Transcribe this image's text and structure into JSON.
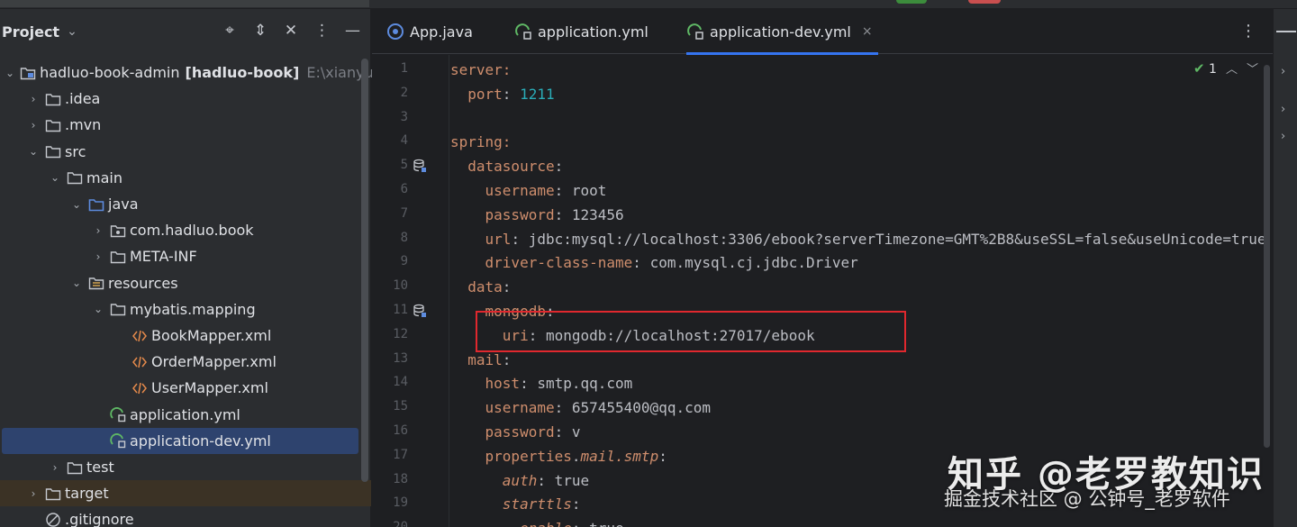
{
  "project_panel": {
    "title": "Project",
    "tools": [
      "locate-icon",
      "expand-collapse-icon",
      "close-all-icon",
      "more-icon",
      "minimize-icon"
    ],
    "tree": [
      {
        "label": "hadluo-book-admin",
        "extra_bold": "[hadluo-book]",
        "path": "E:\\xianyu_ga",
        "icon": "module-folder-icon",
        "expanded": true
      },
      {
        "label": ".idea",
        "icon": "folder-icon",
        "expanded": false
      },
      {
        "label": ".mvn",
        "icon": "folder-icon",
        "expanded": false
      },
      {
        "label": "src",
        "icon": "folder-icon",
        "expanded": true
      },
      {
        "label": "main",
        "icon": "folder-icon",
        "expanded": true
      },
      {
        "label": "java",
        "icon": "source-folder-icon",
        "expanded": true
      },
      {
        "label": "com.hadluo.book",
        "icon": "package-icon",
        "expanded": false
      },
      {
        "label": "META-INF",
        "icon": "folder-icon",
        "expanded": false
      },
      {
        "label": "resources",
        "icon": "resources-folder-icon",
        "expanded": true
      },
      {
        "label": "mybatis.mapping",
        "icon": "folder-icon",
        "expanded": true
      },
      {
        "label": "BookMapper.xml",
        "icon": "xml-icon"
      },
      {
        "label": "OrderMapper.xml",
        "icon": "xml-icon"
      },
      {
        "label": "UserMapper.xml",
        "icon": "xml-icon"
      },
      {
        "label": "application.yml",
        "icon": "spring-yml-icon"
      },
      {
        "label": "application-dev.yml",
        "icon": "spring-yml-icon",
        "selected": true
      },
      {
        "label": "test",
        "icon": "folder-icon",
        "expanded": false
      },
      {
        "label": "target",
        "icon": "folder-icon",
        "expanded": false,
        "highlight": true
      },
      {
        "label": ".gitignore",
        "icon": "ignore-icon"
      }
    ]
  },
  "editor": {
    "tabs": [
      {
        "label": "App.java",
        "icon": "java-class-icon"
      },
      {
        "label": "application.yml",
        "icon": "spring-yml-icon"
      },
      {
        "label": "application-dev.yml",
        "icon": "spring-yml-icon",
        "active": true,
        "close": "×"
      }
    ],
    "inspection": {
      "count": "1"
    },
    "lines": [
      {
        "n": "1",
        "tokens": [
          {
            "t": "server:",
            "c": "k"
          }
        ]
      },
      {
        "n": "2",
        "tokens": [
          {
            "t": "  "
          },
          {
            "t": "port",
            "c": "k"
          },
          {
            "t": ": "
          },
          {
            "t": "1211",
            "c": "n"
          }
        ]
      },
      {
        "n": "3",
        "tokens": []
      },
      {
        "n": "4",
        "tokens": [
          {
            "t": "spring:",
            "c": "k"
          }
        ]
      },
      {
        "n": "5",
        "tokens": [
          {
            "t": "  "
          },
          {
            "t": "datasource",
            "c": "k"
          },
          {
            "t": ":"
          }
        ]
      },
      {
        "n": "6",
        "tokens": [
          {
            "t": "    "
          },
          {
            "t": "username",
            "c": "k"
          },
          {
            "t": ": root"
          }
        ]
      },
      {
        "n": "7",
        "tokens": [
          {
            "t": "    "
          },
          {
            "t": "password",
            "c": "k"
          },
          {
            "t": ": 123456"
          }
        ]
      },
      {
        "n": "8",
        "tokens": [
          {
            "t": "    "
          },
          {
            "t": "url",
            "c": "k"
          },
          {
            "t": ": jdbc:mysql://localhost:3306/ebook?serverTimezone=GMT%2B8&useSSL=false&useUnicode=true"
          }
        ]
      },
      {
        "n": "9",
        "tokens": [
          {
            "t": "    "
          },
          {
            "t": "driver-class-name",
            "c": "k"
          },
          {
            "t": ": com.mysql.cj.jdbc.Driver"
          }
        ]
      },
      {
        "n": "10",
        "tokens": [
          {
            "t": "  "
          },
          {
            "t": "data",
            "c": "k"
          },
          {
            "t": ":"
          }
        ]
      },
      {
        "n": "11",
        "tokens": [
          {
            "t": "    "
          },
          {
            "t": "mongodb",
            "c": "k"
          },
          {
            "t": ":"
          }
        ]
      },
      {
        "n": "12",
        "tokens": [
          {
            "t": "      "
          },
          {
            "t": "uri",
            "c": "k"
          },
          {
            "t": ": mongodb://localhost:27017/ebook"
          }
        ]
      },
      {
        "n": "13",
        "tokens": [
          {
            "t": "  "
          },
          {
            "t": "mail",
            "c": "k"
          },
          {
            "t": ":"
          }
        ]
      },
      {
        "n": "14",
        "tokens": [
          {
            "t": "    "
          },
          {
            "t": "host",
            "c": "k"
          },
          {
            "t": ": smtp.qq.com"
          }
        ]
      },
      {
        "n": "15",
        "tokens": [
          {
            "t": "    "
          },
          {
            "t": "username",
            "c": "k"
          },
          {
            "t": ": 657455400@qq.com"
          }
        ]
      },
      {
        "n": "16",
        "tokens": [
          {
            "t": "    "
          },
          {
            "t": "password",
            "c": "k"
          },
          {
            "t": ": v"
          }
        ]
      },
      {
        "n": "17",
        "tokens": [
          {
            "t": "    "
          },
          {
            "t": "properties",
            "c": "k"
          },
          {
            "t": "."
          },
          {
            "t": "mail.smtp",
            "c": "k it"
          },
          {
            "t": ":"
          }
        ]
      },
      {
        "n": "18",
        "tokens": [
          {
            "t": "      "
          },
          {
            "t": "auth",
            "c": "k it"
          },
          {
            "t": ": true"
          }
        ]
      },
      {
        "n": "19",
        "tokens": [
          {
            "t": "      "
          },
          {
            "t": "starttls",
            "c": "k it"
          },
          {
            "t": ":"
          }
        ]
      },
      {
        "n": "20",
        "tokens": [
          {
            "t": "        "
          },
          {
            "t": "enable",
            "c": "k it"
          },
          {
            "t": ": true"
          }
        ]
      }
    ]
  },
  "watermark": {
    "title": "知乎 @老罗教知识",
    "subtitle": "掘金技术社区 @ 公钟号_老罗软件"
  },
  "colors": {
    "key": "#cf8e6d",
    "number": "#2aacb8",
    "selection": "#2e436e",
    "annotation_box": "#e0282e",
    "tab_underline": "#3574f0"
  }
}
